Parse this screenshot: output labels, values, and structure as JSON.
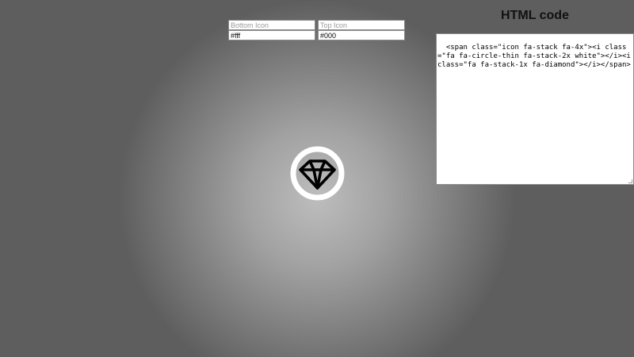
{
  "inputs": {
    "bottom_icon_placeholder": "Bottom Icon",
    "top_icon_placeholder": "Top Icon",
    "bottom_icon_value": "#fff",
    "top_icon_value": "#000"
  },
  "panel": {
    "title": "HTML code",
    "code": "<span class=\"icon fa-stack fa-4x\"><i class=\"fa fa-circle-thin fa-stack-2x white\"></i><i class=\"fa fa-stack-1x fa-diamond\"></i></span>"
  },
  "preview": {
    "bottom_icon": "circle-thin-icon",
    "top_icon": "diamond-icon",
    "bottom_color": "#ffffff",
    "top_color": "#000000"
  }
}
